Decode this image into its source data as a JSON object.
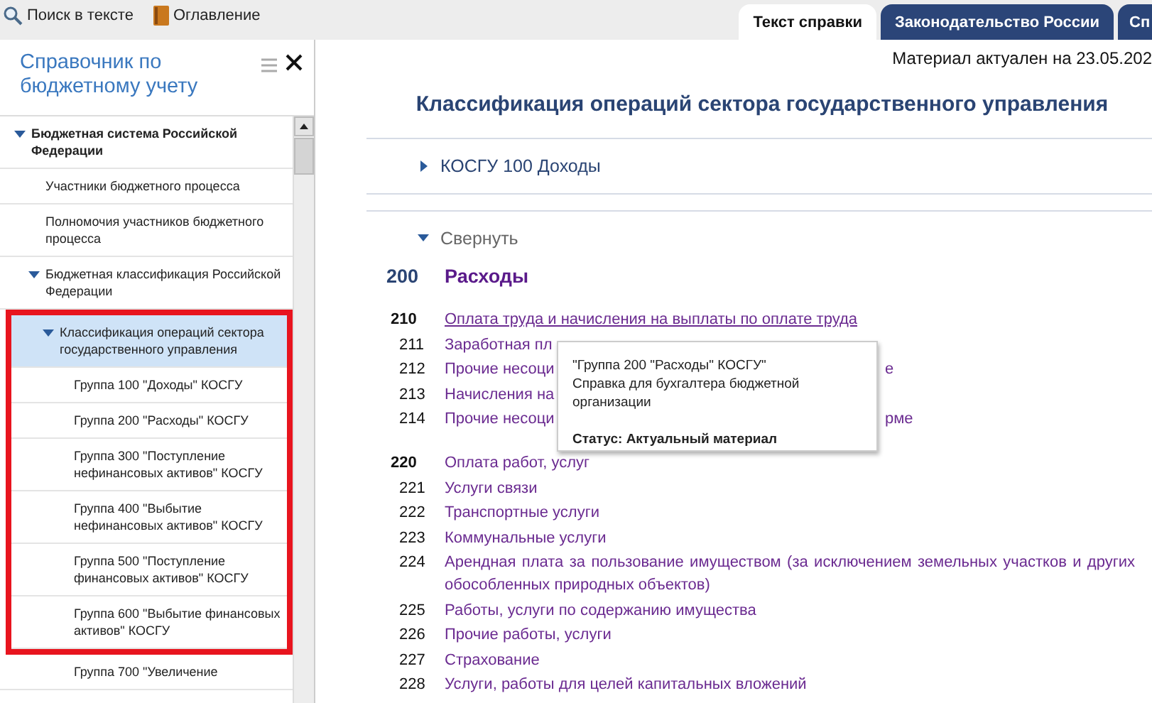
{
  "toolbar": {
    "buttons": [
      {
        "kind": "search",
        "label": "Поиск в тексте"
      },
      {
        "kind": "contents",
        "label": "Оглавление"
      }
    ]
  },
  "tabs": [
    {
      "label": "Текст справки",
      "selected": true
    },
    {
      "label": "Законодательство России",
      "selected": false
    },
    {
      "label": "Сп",
      "selected": false
    }
  ],
  "sidebar": {
    "title": "Справочник по бюджетному учету",
    "tree": [
      {
        "label": "Бюджетная система Российской Федерации",
        "expanded": true,
        "selected": false,
        "framed": false,
        "children": [
          {
            "label": "Участники бюджетного процесса",
            "selected": false,
            "framed": false
          },
          {
            "label": "Полномочия участников бюджетного процесса",
            "selected": false,
            "framed": false
          },
          {
            "label": "Бюджетная классификация Российской Федерации",
            "expanded": true,
            "selected": false,
            "framed": false,
            "children": [
              {
                "label": "Классификация операций сектора государственного управления",
                "expanded": true,
                "selected": true,
                "framed": true,
                "children": [
                  {
                    "label": "Группа 100 \"Доходы\" КОСГУ",
                    "selected": false,
                    "framed": true
                  },
                  {
                    "label": "Группа 200 \"Расходы\" КОСГУ",
                    "selected": false,
                    "framed": true
                  },
                  {
                    "label": "Группа 300 \"Поступление нефинансовых активов\" КОСГУ",
                    "selected": false,
                    "framed": true
                  },
                  {
                    "label": "Группа 400 \"Выбытие нефинансовых активов\" КОСГУ",
                    "selected": false,
                    "framed": true
                  },
                  {
                    "label": "Группа 500 \"Поступление финансовых активов\" КОСГУ",
                    "selected": false,
                    "framed": true
                  },
                  {
                    "label": "Группа 600 \"Выбытие финансовых активов\" КОСГУ",
                    "selected": false,
                    "framed": true
                  },
                  {
                    "label": "Группа 700 \"Увеличение",
                    "selected": false,
                    "framed": false
                  }
                ]
              }
            ]
          }
        ]
      }
    ]
  },
  "content": {
    "updated": "Материал актуален на 23.05.202",
    "title": "Классификация операций сектора государственного управления",
    "sections": [
      {
        "label": "КОСГУ 100 Доходы",
        "expanded": false
      },
      {
        "label": "Свернуть",
        "expanded": true
      }
    ],
    "heading": {
      "code": "200",
      "label": "Расходы"
    },
    "rows": [
      {
        "kind": "group",
        "code": "210",
        "text": "Оплата труда и начисления на выплаты по оплате труда",
        "hovered": true
      },
      {
        "kind": "item",
        "code": "211",
        "text": "Заработная пл",
        "hovered": false
      },
      {
        "kind": "item",
        "code": "212",
        "text": "Прочие несоци",
        "tail": "е",
        "hovered": false
      },
      {
        "kind": "item",
        "code": "213",
        "text": "Начисления на",
        "hovered": false
      },
      {
        "kind": "item",
        "code": "214",
        "text": "Прочие несоци",
        "tail": "рме",
        "hovered": false
      },
      {
        "kind": "group",
        "code": "220",
        "text": "Оплата работ, услуг",
        "hovered": false
      },
      {
        "kind": "item",
        "code": "221",
        "text": "Услуги связи",
        "hovered": false
      },
      {
        "kind": "item",
        "code": "222",
        "text": "Транспортные услуги",
        "hovered": false
      },
      {
        "kind": "item",
        "code": "223",
        "text": "Коммунальные услуги",
        "hovered": false
      },
      {
        "kind": "item",
        "code": "224",
        "text": "Арендная плата за пользование имуществом (за исключением земельных участков и других обособленных природных объектов)",
        "hovered": false
      },
      {
        "kind": "item",
        "code": "225",
        "text": "Работы, услуги по содержанию имущества",
        "hovered": false
      },
      {
        "kind": "item",
        "code": "226",
        "text": "Прочие работы, услуги",
        "hovered": false
      },
      {
        "kind": "item",
        "code": "227",
        "text": "Страхование",
        "hovered": false
      },
      {
        "kind": "item",
        "code": "228",
        "text": "Услуги, работы для целей капитальных вложений",
        "hovered": false
      }
    ],
    "tooltip": {
      "title": "\"Группа 200 \"Расходы\" КОСГУ\"",
      "subtitle": "Справка для бухгалтера бюджетной организации",
      "status": "Статус: Актуальный материал"
    }
  }
}
